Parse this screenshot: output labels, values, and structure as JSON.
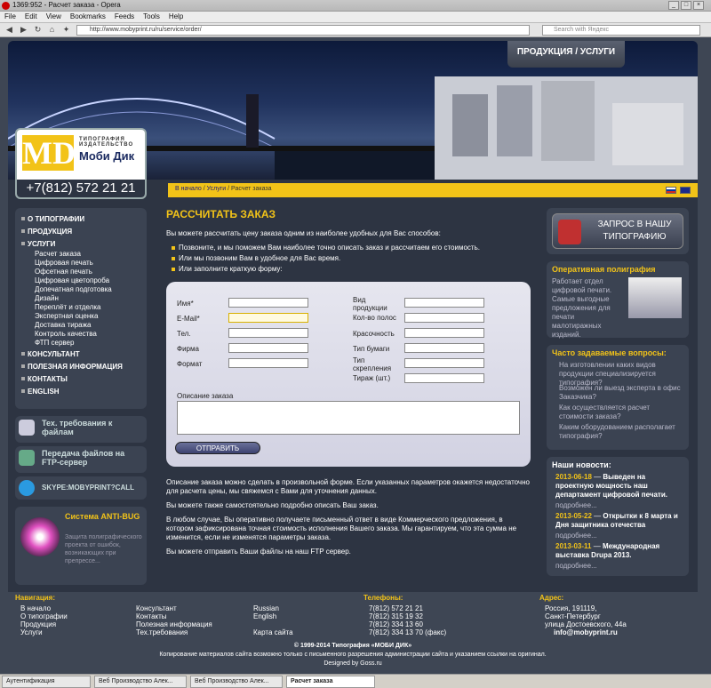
{
  "browser": {
    "title": "1369:952 - Расчет заказа - Opera",
    "menu": [
      "File",
      "Edit",
      "View",
      "Bookmarks",
      "Feeds",
      "Tools",
      "Help"
    ],
    "url": "http://www.mobyprint.ru/ru/service/order/",
    "search_placeholder": "Search with Яндекс"
  },
  "header": {
    "products_tab": "ПРОДУКЦИЯ / УСЛУГИ",
    "logo_tag": "ТИПОГРАФИЯ ИЗДАТЕЛЬСТВО",
    "logo_name": "Моби Дик",
    "phone": "+7(812) 572 21 21"
  },
  "breadcrumb": [
    "В начало",
    "Услуги",
    "Расчет заказа"
  ],
  "leftnav": {
    "top": [
      "О ТИПОГРАФИИ",
      "ПРОДУКЦИЯ",
      "УСЛУГИ"
    ],
    "sub": [
      "Расчет заказа",
      "Цифровая печать",
      "Офсетная печать",
      "Цифровая цветопроба",
      "Допечатная подготовка",
      "Дизайн",
      "Переплёт и отделка",
      "Экспертная оценка",
      "Доставка тиража",
      "Контроль качества",
      "ФТП сервер"
    ],
    "bottom": [
      "КОНСУЛЬТАНТ",
      "ПОЛЕЗНАЯ ИНФОРМАЦИЯ",
      "КОНТАКТЫ",
      "ENGLISH"
    ]
  },
  "side": {
    "req": "Тех. требования к файлам",
    "ftp": "Передача файлов на FTP-сервер",
    "skype": "SKYPE:MOBYPRINT?CALL",
    "antibug_title": "Система ANTI-BUG",
    "antibug_text": "Защита полиграфического проекта от ошибок, возникающих при препрессе..."
  },
  "main": {
    "title": "РАССЧИТАТЬ ЗАКАЗ",
    "intro": "Вы можете рассчитать цену заказа одним из наиболее удобных для Вас способов:",
    "ways": [
      "Позвоните, и мы поможем Вам наиболее точно описать заказ и рассчитаем его стоимость.",
      "Или мы позвоним Вам в удобное для Вас время.",
      "Или заполните краткую форму:"
    ],
    "form": {
      "left": [
        "Имя*",
        "E-Mail*",
        "Тел.",
        "Фирма",
        "Формат"
      ],
      "right": [
        "Вид продукции",
        "Кол-во полос",
        "Красочность",
        "Тип бумаги",
        "Тип скрепления",
        "Тираж (шт.)"
      ],
      "desc_label": "Описание заказа",
      "submit": "ОТПРАВИТЬ"
    },
    "p1": "Описание заказа можно сделать в произвольной форме. Если указанных параметров окажется недостаточно для расчета цены, мы свяжемся с Вами для уточнения данных.",
    "p2": "Вы можете также самостоятельно подробно описать Ваш заказ.",
    "p3": "В любом случае, Вы оперативно получаете письменный ответ в виде Коммерческого предложения, в котором зафиксирована точная стоимость исполнения Вашего заказа. Мы гарантируем, что эта сумма не изменится, если не изменятся параметры заказа.",
    "p4": "Вы можете отправить Ваши файлы на наш FTP сервер."
  },
  "right": {
    "request_btn": "ЗАПРОС В НАШУ ТИПОГРАФИЮ",
    "op_title": "Оперативная полиграфия",
    "op_text": "Работает отдел цифровой печати. Самые выгодные предложения для печати малотиражных изданий.",
    "faq_title": "Часто задаваемые вопросы:",
    "faq": [
      "На изготовлении каких видов продукции специализируется типография?",
      "Возможен ли выезд эксперта в офис Заказчика?",
      "Как осуществляется расчет стоимости заказа?",
      "Каким оборудованием располагает типография?"
    ],
    "more": "подробнее...",
    "news_title": "Наши новости:",
    "news": [
      {
        "date": "2013-06-18",
        "text": "Выведен на проектную мощность наш департамент цифровой печати."
      },
      {
        "date": "2013-05-22",
        "text": "Открытки к 8 марта и Дня защитника отечества"
      },
      {
        "date": "2013-03-11",
        "text": "Международная выставка Drupa 2013."
      }
    ]
  },
  "footer": {
    "nav_title": "Навигация:",
    "col1": [
      "В начало",
      "О типографии",
      "Продукция",
      "Услуги"
    ],
    "col2": [
      "Консультант",
      "Контакты",
      "Полезная информация",
      "Тех.требования"
    ],
    "col3": [
      "Russian",
      "English",
      "",
      "Карта сайта"
    ],
    "phones_title": "Телефоны:",
    "phones": [
      "7(812) 572 21 21",
      "7(812) 315 19 32",
      "7(812) 334 13 60",
      "7(812) 334 13 70 (факс)"
    ],
    "addr_title": "Адрес:",
    "addr": [
      "Россия, 191119,",
      "Санкт-Петербург",
      "улица Достоевского, 44а",
      "info@mobyprint.ru"
    ],
    "copy1": "© 1999-2014 Типография «МОБИ ДИК»",
    "copy2": "Копирование материалов сайта возможно только с письменного разрешения администрации сайта и указанием ссылки на оригинал.",
    "copy3": "Designed by Goss.ru"
  },
  "taskbar": [
    "Аутентификация",
    "Веб Производство Алек...",
    "Веб Производство Алек...",
    "Расчет заказа"
  ]
}
